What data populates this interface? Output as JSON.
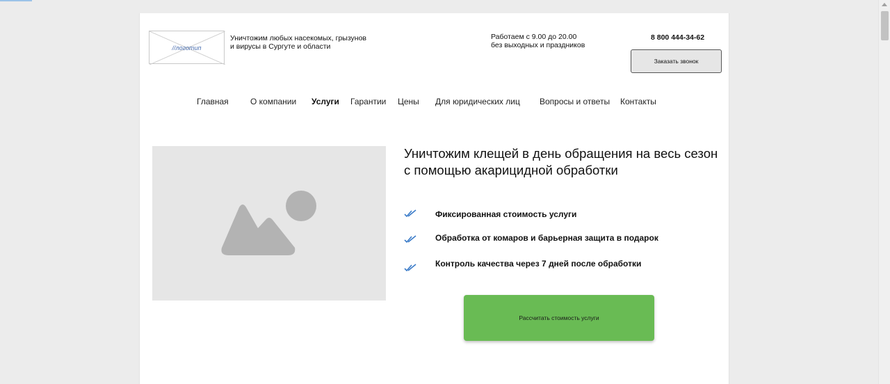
{
  "header": {
    "logo_text": "//логотип",
    "tagline": [
      "Уничтожим любых насекомых, грызунов",
      "и вирусы в Сургуте и области"
    ],
    "hours": [
      "Работаем с 9.00 до 20.00",
      "без выходных и праздников"
    ],
    "phone": "8 800 444-34-62",
    "callback_label": "Заказать звонок"
  },
  "nav": {
    "items": [
      {
        "label": "Главная",
        "active": false
      },
      {
        "label": "О компании",
        "active": false
      },
      {
        "label": "Услуги",
        "active": true
      },
      {
        "label": "Гарантии",
        "active": false
      },
      {
        "label": "Цены",
        "active": false
      },
      {
        "label": "Для юридических лиц",
        "active": false
      },
      {
        "label": "Вопросы и ответы",
        "active": false
      },
      {
        "label": "Контакты",
        "active": false
      }
    ]
  },
  "hero": {
    "title": [
      "Уничтожим клещей в день обращения на весь сезон",
      "с помощью акарицидной обработки"
    ],
    "features": [
      "Фиксированная стоимость услуги",
      "Обработка от комаров и барьерная защита в подарок",
      "Контроль качества через 7 дней после обработки"
    ],
    "cta_label": "Рассчитать стоимость услуги",
    "image_icon": "image-placeholder-icon"
  },
  "colors": {
    "cta": "#69bb54",
    "check": "#3a7bc8",
    "placeholder": "#e6e6e6",
    "placeholder_shape": "#b3b3b3"
  }
}
